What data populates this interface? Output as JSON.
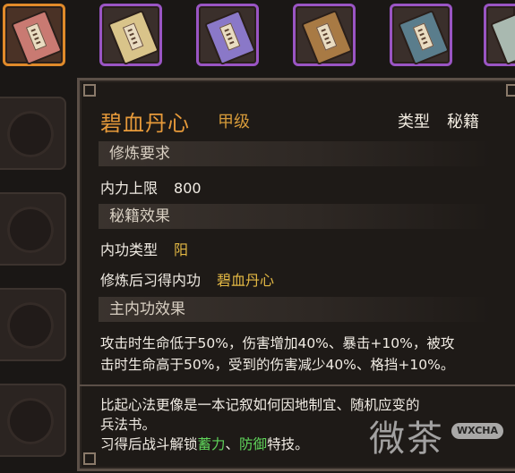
{
  "inventory": {
    "slots": [
      {
        "item": "book-red",
        "selected": true,
        "color": "#c97a72"
      },
      {
        "item": "book-tan",
        "selected": false,
        "color": "#d9c48a"
      },
      {
        "item": "book-purple",
        "selected": false,
        "color": "#8a78c8"
      },
      {
        "item": "book-brown",
        "selected": false,
        "color": "#a87a44"
      },
      {
        "item": "book-blue",
        "selected": false,
        "color": "#5a7d8c"
      },
      {
        "item": "book-teal",
        "selected": false,
        "color": "#a9b9b0"
      }
    ]
  },
  "tooltip": {
    "name": "碧血丹心",
    "grade": "甲级",
    "type_label": "类型",
    "type_value": "秘籍",
    "req_header": "修炼要求",
    "req_label": "内力上限",
    "req_value": "800",
    "effect_header": "秘籍效果",
    "kungfu_type_label": "内功类型",
    "kungfu_type_value": "阳",
    "learn_label": "修炼后习得内功",
    "learn_value": "碧血丹心",
    "main_header": "主内功效果",
    "main_effect_line1": "攻击时生命低于50%，伤害增加40%、暴击+10%，被攻",
    "main_effect_line2": "击时生命高于50%，受到的伤害减少40%、格挡+10%。",
    "desc_line1": "比起心法更像是一本记叙如何因地制宜、随机应变的",
    "desc_line2": "兵法书。",
    "desc_line3_pre": "习得后战斗解锁",
    "desc_skill1": "蓄力",
    "desc_sep": "、",
    "desc_skill2": "防御",
    "desc_line3_post": "特技。"
  },
  "watermark": {
    "text": "微茶",
    "badge": "WXCHA"
  },
  "colors": {
    "title": "#e79a3a",
    "gold": "#e3b844",
    "green": "#5fd35a",
    "selected_border": "#e08a2a",
    "slot_border": "#9a55c4"
  }
}
